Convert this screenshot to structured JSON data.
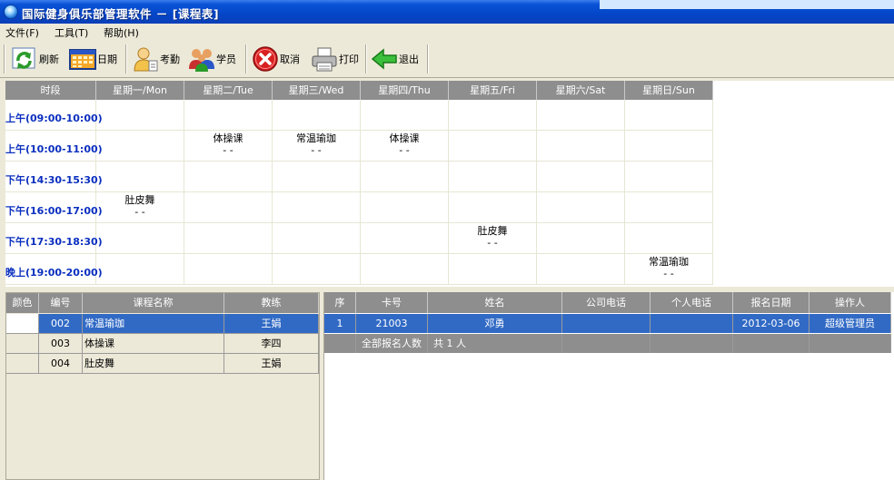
{
  "window": {
    "title": "国际健身俱乐部管理软件 － [课程表]"
  },
  "menu": [
    {
      "label": "文件(F)"
    },
    {
      "label": "工具(T)"
    },
    {
      "label": "帮助(H)"
    }
  ],
  "toolbar": {
    "refresh": "刷新",
    "date": "日期",
    "attendance": "考勤",
    "members": "学员",
    "cancel": "取消",
    "print": "打印",
    "exit": "退出"
  },
  "schedule": {
    "period_header": "时段",
    "days": [
      "星期一/Mon",
      "星期二/Tue",
      "星期三/Wed",
      "星期四/Thu",
      "星期五/Fri",
      "星期六/Sat",
      "星期日/Sun"
    ],
    "periods": [
      "上午(09:00-10:00)",
      "上午(10:00-11:00)",
      "下午(14:30-15:30)",
      "下午(16:00-17:00)",
      "下午(17:30-18:30)",
      "晚上(19:00-20:00)"
    ],
    "entries": [
      {
        "period": 1,
        "day": 1,
        "name": "体操课",
        "sub": "- -"
      },
      {
        "period": 1,
        "day": 2,
        "name": "常温瑜珈",
        "sub": "- -"
      },
      {
        "period": 1,
        "day": 3,
        "name": "体操课",
        "sub": "- -"
      },
      {
        "period": 3,
        "day": 0,
        "name": "肚皮舞",
        "sub": "- -"
      },
      {
        "period": 4,
        "day": 4,
        "name": "肚皮舞",
        "sub": "- -"
      },
      {
        "period": 5,
        "day": 6,
        "name": "常温瑜珈",
        "sub": "- -"
      }
    ]
  },
  "course_table": {
    "headers": [
      "颜色",
      "编号",
      "课程名称",
      "教练"
    ],
    "rows": [
      {
        "id": "002",
        "name": "常温瑜珈",
        "coach": "王娟",
        "selected": true
      },
      {
        "id": "003",
        "name": "体操课",
        "coach": "李四",
        "selected": false
      },
      {
        "id": "004",
        "name": "肚皮舞",
        "coach": "王娟",
        "selected": false
      }
    ]
  },
  "member_table": {
    "headers": [
      "序",
      "卡号",
      "姓名",
      "公司电话",
      "个人电话",
      "报名日期",
      "操作人"
    ],
    "rows": [
      {
        "seq": "1",
        "card": "21003",
        "name": "邓勇",
        "company_phone": "",
        "personal_phone": "",
        "date": "2012-03-06",
        "operator": "超级管理员"
      }
    ],
    "summary_label": "全部报名人数",
    "summary_value": "共 1 人"
  },
  "colors": {
    "title_bar": "#0446c8",
    "header_gray": "#8e8e8e",
    "period_blue": "#0a2fbf",
    "selection": "#316ac5"
  }
}
